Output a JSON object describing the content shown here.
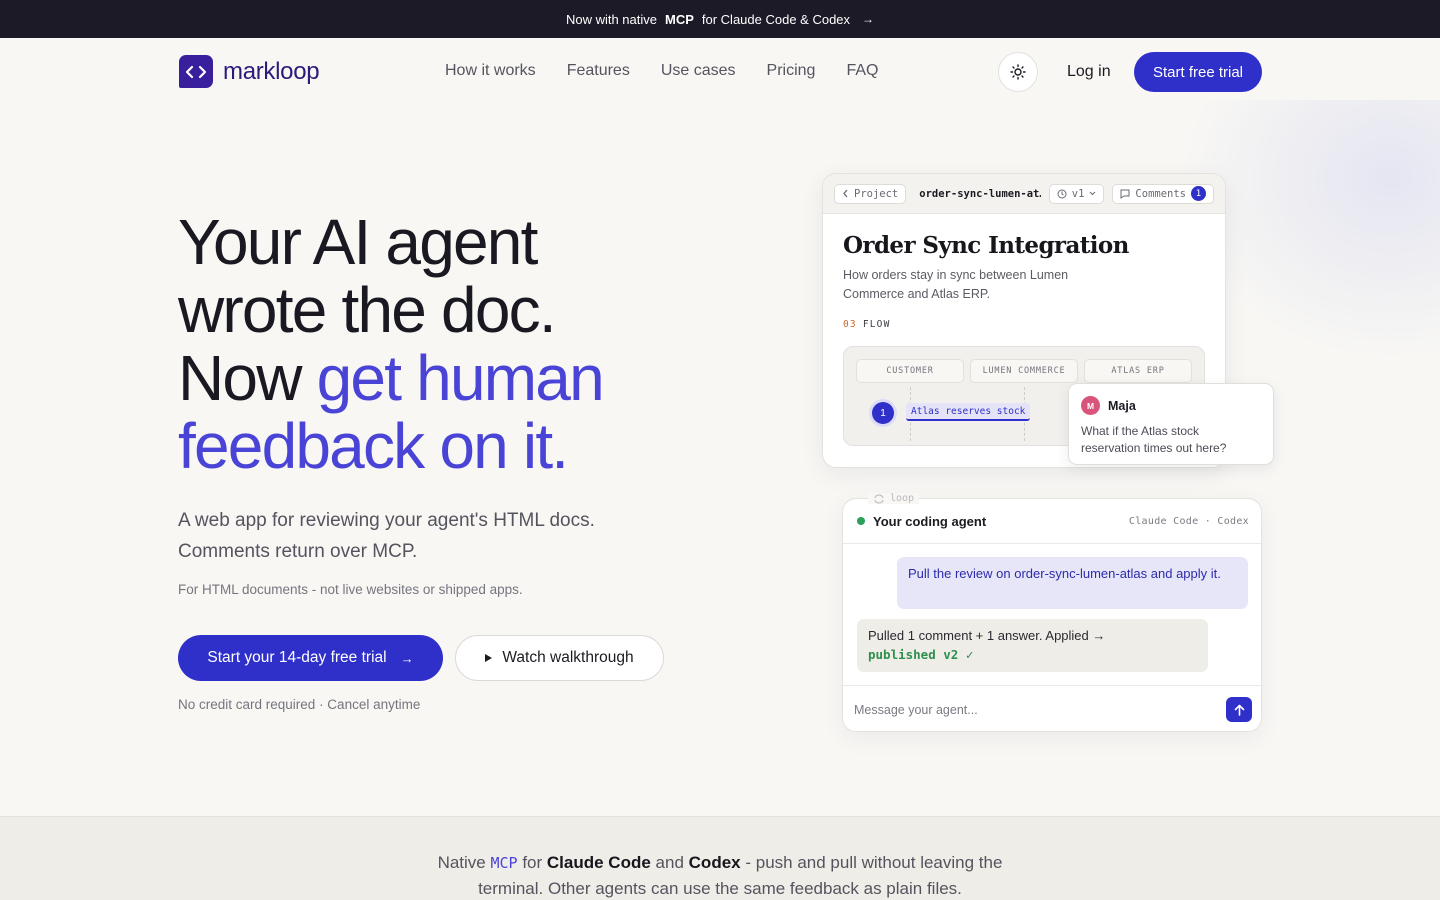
{
  "announcement": {
    "prefix": "Now with native",
    "highlight": "MCP",
    "suffix": "for Claude Code & Codex",
    "arrow": "→"
  },
  "nav": {
    "brand": "markloop",
    "links": [
      "How it works",
      "Features",
      "Use cases",
      "Pricing",
      "FAQ"
    ],
    "login": "Log in",
    "cta": "Start free trial"
  },
  "hero": {
    "headline_line1": "Your AI agent",
    "headline_line2": "wrote the doc.",
    "headline_line3_plain": "Now ",
    "headline_line3_accent": "get human",
    "headline_line4_accent": "feedback on it.",
    "lead_line1": "A web app for reviewing your agent's HTML docs.",
    "lead_line2": "Comments return over MCP.",
    "fine_print": "For HTML documents - not live websites or shipped apps.",
    "primary_cta": "Start your 14-day free trial",
    "primary_cta_arrow": "→",
    "secondary_cta": "Watch walkthrough",
    "no_card": "No credit card required · Cancel anytime"
  },
  "doc_preview": {
    "back_label": "Project",
    "file_name": "order-sync-lumen-at…",
    "version": "v1",
    "comments_label": "Comments",
    "comments_count": "1",
    "title": "Order Sync Integration",
    "subtitle": "How orders stay in sync between Lumen Commerce and Atlas ERP.",
    "section_number": "03",
    "section_label": "FLOW",
    "lanes": [
      "CUSTOMER",
      "LUMEN COMMERCE",
      "ATLAS ERP"
    ],
    "step_number": "1",
    "step_label": "Atlas reserves stock"
  },
  "comment": {
    "avatar_initial": "M",
    "author": "Maja",
    "text": "What if the Atlas stock reservation times out here?"
  },
  "agent": {
    "loop_tag": "loop",
    "name": "Your coding agent",
    "tools": "Claude Code · Codex",
    "user_message": "Pull the review on order-sync-lumen-atlas and apply it.",
    "agent_message": "Pulled 1 comment + 1 answer. Applied →",
    "agent_status": "published v2 ✓",
    "input_placeholder": "Message your agent..."
  },
  "band": {
    "w1": "Native",
    "code": "MCP",
    "w2": "for",
    "b1": "Claude Code",
    "w3": "and",
    "b2": "Codex",
    "w4": "- push and pull without leaving the",
    "line2": "terminal. Other agents can use the same feedback as plain files."
  },
  "colors": {
    "accent": "#2f2fc9",
    "headline_accent": "#4a44d6",
    "topbar": "#1b1a26",
    "status_green": "#2b9f5b",
    "avatar_pink": "#d9547a"
  }
}
